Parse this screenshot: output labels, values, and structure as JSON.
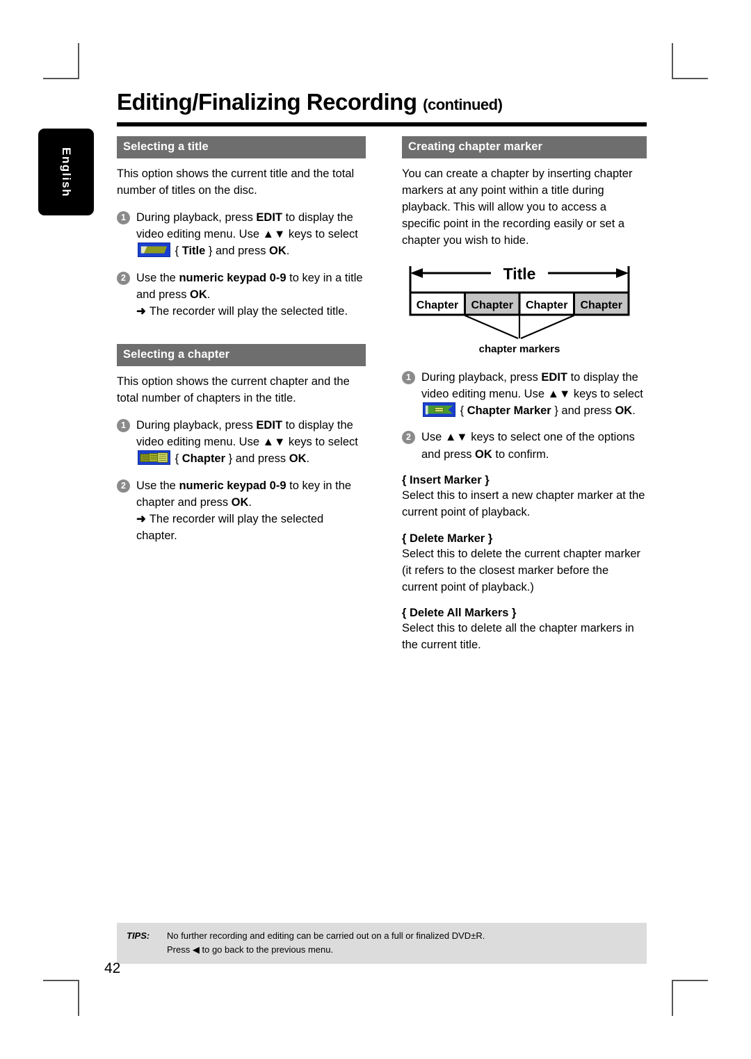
{
  "page": {
    "title": "Editing/Finalizing Recording",
    "title_suffix": "(continued)",
    "language_tab": "English",
    "page_number": "42",
    "header_bar_color": "#6e6e6e",
    "osd_highlight_color": "#1a3fd0",
    "osd_icon_color": "#8d9a1e"
  },
  "left_column": {
    "section1": {
      "heading": "Selecting a title",
      "intro": "This option shows the current title and the total number of titles on the disc.",
      "steps": [
        {
          "num": "1",
          "text_before_icon": "During playback, press EDIT to display the video editing menu. Use ▲▼ keys to select",
          "icon": "title-osd-icon",
          "text_after_icon": "{ Title } and press OK.",
          "bold_terms": [
            "EDIT",
            "Title",
            "OK"
          ]
        },
        {
          "num": "2",
          "text": "Use the numeric keypad 0-9 to key in a title and press OK.",
          "bold_terms": [
            "numeric keypad 0-9",
            "OK"
          ],
          "result_arrow": "➜",
          "result": "The recorder will play the selected title."
        }
      ]
    },
    "section2": {
      "heading": "Selecting a chapter",
      "intro": "This option shows the current chapter and the total number of chapters in the title.",
      "steps": [
        {
          "num": "1",
          "text_before_icon": "During playback, press EDIT to display the video editing menu. Use ▲▼ keys to select",
          "icon": "chapter-osd-icon",
          "text_after_icon": "{ Chapter } and press OK.",
          "bold_terms": [
            "EDIT",
            "Chapter",
            "OK"
          ]
        },
        {
          "num": "2",
          "text": "Use the numeric keypad 0-9 to key in the chapter and press OK.",
          "bold_terms": [
            "numeric keypad 0-9",
            "OK"
          ],
          "result_arrow": "➜",
          "result": "The recorder will play the selected chapter."
        }
      ]
    }
  },
  "right_column": {
    "section1": {
      "heading": "Creating chapter marker",
      "intro": "You can create a chapter by inserting chapter markers at any point within a title during playback. This will allow you to access a specific point in the recording easily or set a chapter you wish to hide.",
      "diagram": {
        "title_label": "Title",
        "chapter_labels": [
          "Chapter",
          "Chapter",
          "Chapter",
          "Chapter"
        ],
        "caption": "chapter markers"
      },
      "steps": [
        {
          "num": "1",
          "text_before_icon": "During playback, press EDIT to display the video editing menu. Use ▲▼ keys to select",
          "icon": "chapter-marker-osd-icon",
          "text_after_icon": "{ Chapter Marker } and press OK.",
          "bold_terms": [
            "EDIT",
            "Chapter Marker",
            "OK"
          ]
        },
        {
          "num": "2",
          "text": "Use ▲▼ keys to select one of the options and press OK to confirm.",
          "bold_terms": [
            "OK"
          ]
        }
      ],
      "options": [
        {
          "name": "{ Insert Marker }",
          "description": "Select this to insert a new chapter marker at the current point of playback."
        },
        {
          "name": "{ Delete Marker }",
          "description": "Select this to delete the current chapter marker (it refers to the closest marker before the current point of playback.)"
        },
        {
          "name": "{ Delete All Markers }",
          "description": "Select this to delete all the chapter markers in the current title."
        }
      ]
    }
  },
  "tips": {
    "label": "TIPS:",
    "line1": "No further recording and editing can be carried out on a full or finalized DVD±R.",
    "line2_prefix": "Press",
    "line2_arrow": "◀",
    "line2_suffix": "to go back to the previous menu."
  }
}
